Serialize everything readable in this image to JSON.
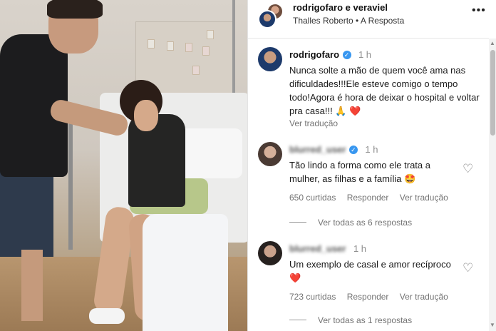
{
  "post": {
    "usernames": "rodrigofaro e veraviel",
    "music": "Thalles Roberto • A Resposta",
    "more_icon": "more-options-icon"
  },
  "caption": {
    "user": "rodrigofaro",
    "time": "1 h",
    "text": "Nunca solte a mão de quem você ama nas dificuldades!!!Ele esteve comigo o tempo todo!Agora é hora de deixar o hospital e voltar pra casa!!! 🙏",
    "heart": "❤️",
    "translate": "Ver tradução"
  },
  "comments": [
    {
      "user": "blurred_user",
      "time": "1 h",
      "text": "Tão lindo a forma como ele trata a mulher, as filhas e a família 🤩",
      "likes": "650 curtidas",
      "reply": "Responder",
      "translate": "Ver tradução",
      "replies": "Ver todas as 6 respostas"
    },
    {
      "user": "blurred_user",
      "time": "1 h",
      "text": "Um exemplo de casal e amor recíproco",
      "heart": "❤️",
      "likes": "723 curtidas",
      "reply": "Responder",
      "translate": "Ver tradução",
      "replies": "Ver todas as 1 respostas"
    }
  ],
  "colors": {
    "verified": "#3897f0",
    "meta": "#737373",
    "heart": "#ed4956"
  }
}
